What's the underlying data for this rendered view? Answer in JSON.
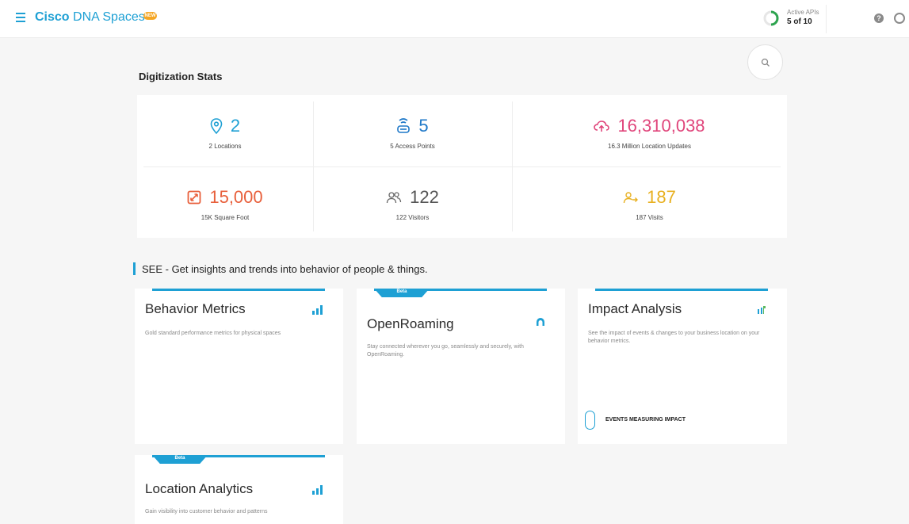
{
  "header": {
    "brand_bold": "Cisco",
    "brand_rest": " DNA Spaces",
    "brand_badge": "NEW",
    "api_label": "Active APIs",
    "api_count": "5 of 10",
    "api_progress": 0.5,
    "help_glyph": "?"
  },
  "stats": {
    "title": "Digitization Stats",
    "items": [
      {
        "value": "2",
        "label": "2 Locations",
        "color": "#1ea0d4",
        "icon": "location-pin-icon"
      },
      {
        "value": "5",
        "label": "5 Access Points",
        "color": "#1e78c8",
        "icon": "access-point-icon"
      },
      {
        "value": "16,310,038",
        "label": "16.3 Million Location Updates",
        "color": "#e0457b",
        "icon": "cloud-upload-icon"
      },
      {
        "value": "15,000",
        "label": "15K Square Foot",
        "color": "#e8603c",
        "icon": "square-area-icon"
      },
      {
        "value": "122",
        "label": "122 Visitors",
        "color": "#666666",
        "icon": "visitors-icon"
      },
      {
        "value": "187",
        "label": "187 Visits",
        "color": "#e8b020",
        "icon": "visits-icon"
      }
    ]
  },
  "see": {
    "title": "SEE - Get insights and trends into behavior of people & things."
  },
  "apps": [
    {
      "title": "Behavior Metrics",
      "desc": "Gold standard performance metrics for physical spaces",
      "icon": "bar-chart-icon"
    },
    {
      "title": "OpenRoaming",
      "desc": "Stay connected wherever you go, seamlessly and securely, with OpenRoaming.",
      "badge": "Beta",
      "icon": "openroaming-icon"
    },
    {
      "title": "Impact Analysis",
      "desc": "See the impact of events & changes to your business location on your behavior metrics.",
      "icon": "flag-chart-icon",
      "events_label": "EVENTS MEASURING IMPACT"
    },
    {
      "title": "Location Analytics",
      "desc": "Gain visibility into customer behavior and patterns",
      "badge": "Beta",
      "icon": "bar-chart-icon"
    }
  ],
  "colors": {
    "accent": "#1ea0d4"
  }
}
